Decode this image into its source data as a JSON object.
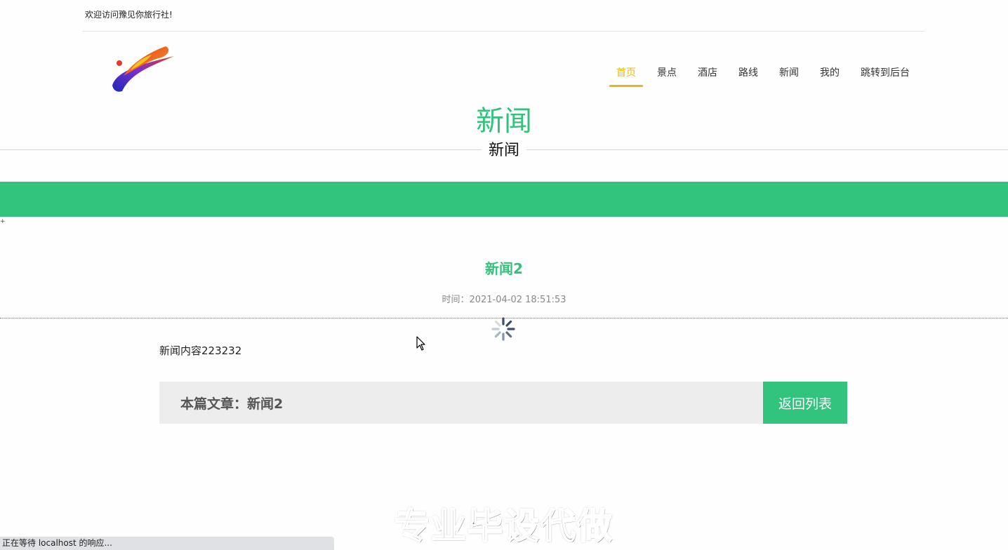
{
  "header": {
    "welcome_text": "欢迎访问豫见你旅行社!"
  },
  "nav": {
    "items": [
      {
        "label": "首页",
        "active": true
      },
      {
        "label": "景点",
        "active": false
      },
      {
        "label": "酒店",
        "active": false
      },
      {
        "label": "路线",
        "active": false
      },
      {
        "label": "新闻",
        "active": false
      },
      {
        "label": "我的",
        "active": false
      },
      {
        "label": "跳转到后台",
        "active": false
      }
    ]
  },
  "section": {
    "title": "新闻",
    "subtitle": "新闻"
  },
  "misc": {
    "plus_mark": "+"
  },
  "article": {
    "title": "新闻2",
    "time": "时间：2021-04-02 18:51:53",
    "content": "新闻内容223232",
    "current_label": "本篇文章：",
    "current_title": "新闻2",
    "back_label": "返回列表"
  },
  "overlay": {
    "watermark": "专业毕设代做"
  },
  "status_bar": {
    "text": "正在等待 localhost 的响应..."
  },
  "colors": {
    "accent_green": "#32c37d",
    "nav_active": "#e6b917",
    "info_bar_bg": "#ecedec"
  },
  "icons": [
    "logo-icon",
    "loading-spinner-icon",
    "mouse-cursor-icon"
  ]
}
